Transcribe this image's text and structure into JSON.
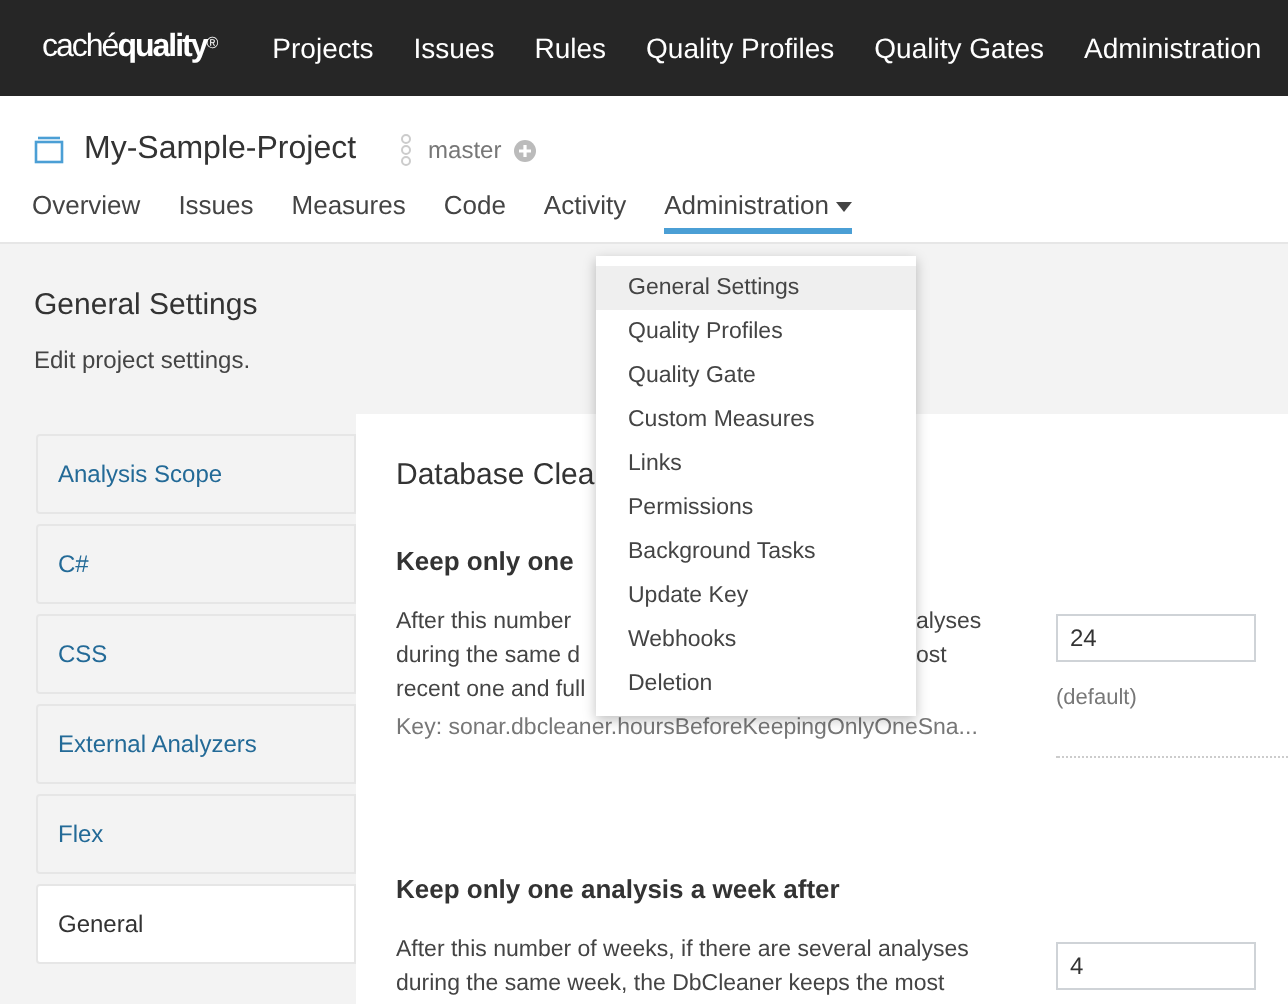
{
  "navbar": {
    "logo_light": "caché",
    "logo_bold": "quality",
    "logo_mark": "®",
    "items": [
      "Projects",
      "Issues",
      "Rules",
      "Quality Profiles",
      "Quality Gates",
      "Administration"
    ]
  },
  "project": {
    "title": "My-Sample-Project",
    "branch": "master"
  },
  "tabs": [
    {
      "label": "Overview",
      "selected": false,
      "dropdown": false
    },
    {
      "label": "Issues",
      "selected": false,
      "dropdown": false
    },
    {
      "label": "Measures",
      "selected": false,
      "dropdown": false
    },
    {
      "label": "Code",
      "selected": false,
      "dropdown": false
    },
    {
      "label": "Activity",
      "selected": false,
      "dropdown": false
    },
    {
      "label": "Administration",
      "selected": true,
      "dropdown": true
    }
  ],
  "dropdown_menu": [
    {
      "label": "General Settings",
      "selected": true
    },
    {
      "label": "Quality Profiles",
      "selected": false
    },
    {
      "label": "Quality Gate",
      "selected": false
    },
    {
      "label": "Custom Measures",
      "selected": false
    },
    {
      "label": "Links",
      "selected": false
    },
    {
      "label": "Permissions",
      "selected": false
    },
    {
      "label": "Background Tasks",
      "selected": false
    },
    {
      "label": "Update Key",
      "selected": false
    },
    {
      "label": "Webhooks",
      "selected": false
    },
    {
      "label": "Deletion",
      "selected": false
    }
  ],
  "page": {
    "title": "General Settings",
    "subtitle": "Edit project settings."
  },
  "categories": [
    {
      "label": "Analysis Scope",
      "selected": false
    },
    {
      "label": "C#",
      "selected": false
    },
    {
      "label": "CSS",
      "selected": false
    },
    {
      "label": "External Analyzers",
      "selected": false
    },
    {
      "label": "Flex",
      "selected": false
    },
    {
      "label": "General",
      "selected": true
    }
  ],
  "section": {
    "title": "Database Clea",
    "settings": [
      {
        "title": "Keep only one",
        "lines": [
          {
            "left": "After this number",
            "right": "alyses"
          },
          {
            "left": "during the same d",
            "right": "ost"
          },
          {
            "left": "recent one and full"
          }
        ],
        "key": "Key: sonar.dbcleaner.hoursBeforeKeepingOnlyOneSna...",
        "value": "24",
        "default_note": "(default)"
      },
      {
        "title": "Keep only one analysis a week after",
        "lines": [
          {
            "left": "After this number of weeks, if there are several analyses"
          },
          {
            "left": "during the same week, the DbCleaner keeps the most"
          }
        ],
        "value": "4"
      }
    ]
  }
}
